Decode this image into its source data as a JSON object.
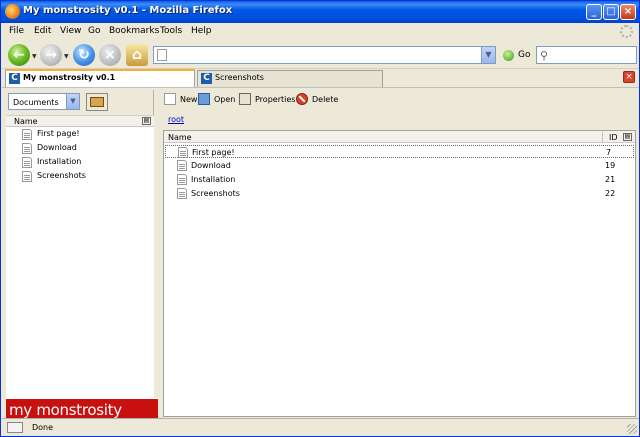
{
  "window": {
    "title": "My monstrosity v0.1 - Mozilla Firefox"
  },
  "menubar": {
    "items": [
      "File",
      "Edit",
      "View",
      "Go",
      "Bookmarks",
      "Tools",
      "Help"
    ]
  },
  "navbar": {
    "url": "",
    "search_value": "",
    "go_label": "Go"
  },
  "tabs": [
    {
      "label": "My monstrosity v0.1",
      "active": true
    },
    {
      "label": "Screenshots",
      "active": false
    }
  ],
  "sidebar": {
    "dropdown_value": "Documents",
    "column_header": "Name",
    "items": [
      "First page!",
      "Download",
      "Installation",
      "Screenshots"
    ],
    "brand": "my monstrosity"
  },
  "main": {
    "actions": [
      "New",
      "Open",
      "Properties",
      "Delete"
    ],
    "breadcrumb": "root",
    "columns": {
      "name": "Name",
      "id": "ID"
    },
    "rows": [
      {
        "name": "First page!",
        "id": "7"
      },
      {
        "name": "Download",
        "id": "19"
      },
      {
        "name": "Installation",
        "id": "21"
      },
      {
        "name": "Screenshots",
        "id": "22"
      }
    ]
  },
  "status": {
    "text": "Done"
  },
  "colors": {
    "titlebar": "#0058e6",
    "brand_red": "#c8100f",
    "link": "#0000cc"
  }
}
